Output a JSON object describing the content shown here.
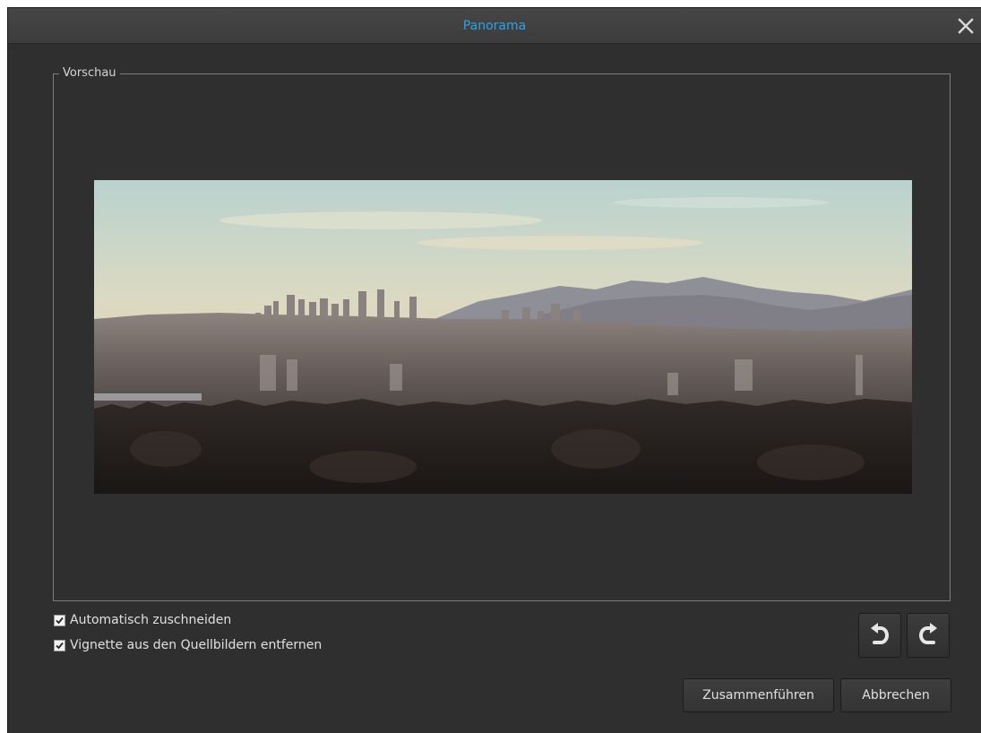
{
  "window": {
    "title": "Panorama",
    "close_icon": "close-icon"
  },
  "preview": {
    "group_label": "Vorschau",
    "image_description_icon": "panorama-preview-image"
  },
  "options": [
    {
      "label": "Automatisch zuschneiden",
      "checked": true
    },
    {
      "label": "Vignette aus den Quellbildern entfernen",
      "checked": true
    }
  ],
  "rotate": {
    "left_icon": "rotate-left-icon",
    "right_icon": "rotate-right-icon"
  },
  "buttons": {
    "merge_label": "Zusammenführen",
    "cancel_label": "Abbrechen"
  },
  "colors": {
    "title": "#2ba3ec",
    "background": "#2f2f2f",
    "titlebar": "#424242"
  }
}
